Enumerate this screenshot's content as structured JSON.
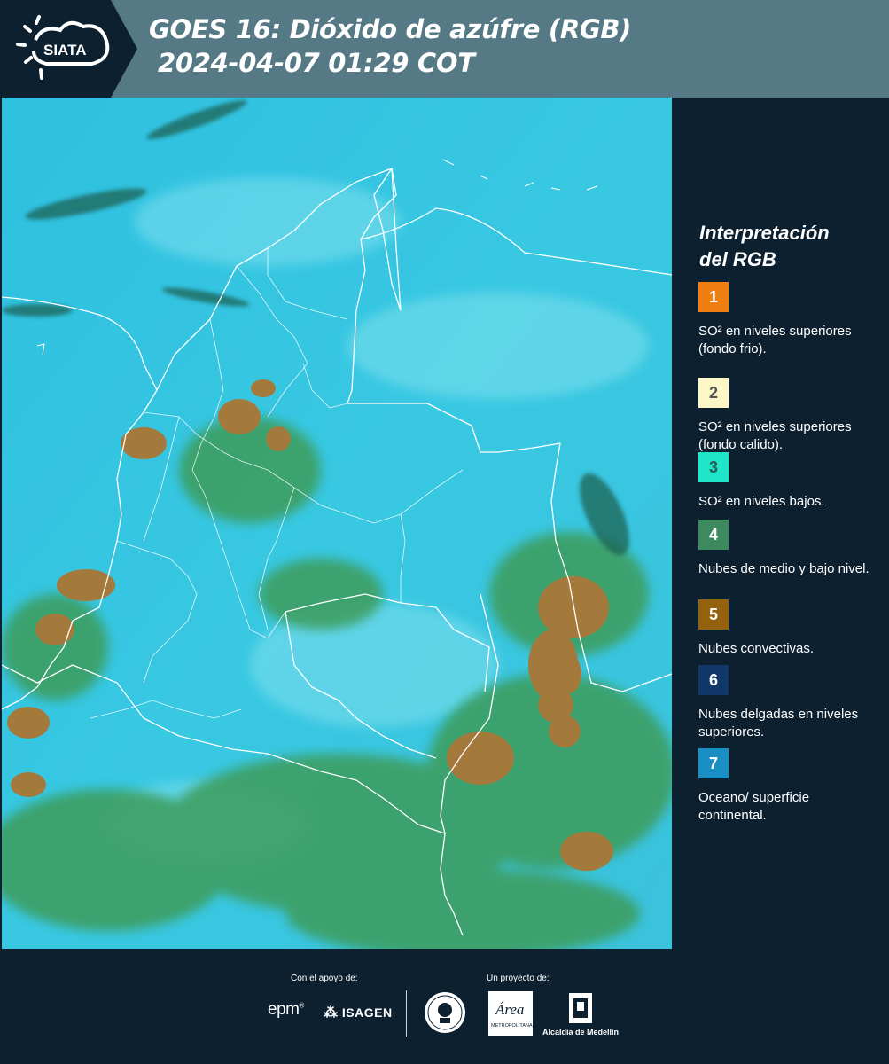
{
  "header": {
    "logo_text": "SIATA",
    "title_line1": "GOES 16: Dióxido de azúfre (RGB)",
    "title_line2": "2024-04-07 01:29 COT"
  },
  "legend": {
    "title_line1": "Interpretación",
    "title_line2": "del RGB",
    "items": [
      {
        "number": "1",
        "color": "#f07f12",
        "text_color": "#ffffff",
        "text": "SO² en niveles superiores (fondo frio)."
      },
      {
        "number": "2",
        "color": "#fdf6c6",
        "text_color": "#555555",
        "text": "SO² en niveles superiores (fondo calido)."
      },
      {
        "number": "3",
        "color": "#1fe6c8",
        "text_color": "#2a5a55",
        "text": "SO² en niveles bajos."
      },
      {
        "number": "4",
        "color": "#3d8a5e",
        "text_color": "#ffffff",
        "text": "Nubes de medio y bajo nivel."
      },
      {
        "number": "5",
        "color": "#94620f",
        "text_color": "#ffffff",
        "text": "Nubes convectivas."
      },
      {
        "number": "6",
        "color": "#12386a",
        "text_color": "#ffffff",
        "text": "Nubes delgadas en niveles superiores."
      },
      {
        "number": "7",
        "color": "#1a8fc4",
        "text_color": "#ffffff",
        "text": "Oceano/ superficie continental."
      }
    ]
  },
  "map": {
    "background_color": "#33c5df",
    "land_cloud_color": "#3f9a5a",
    "convective_color": "#a07a3a",
    "border_color": "#ffffff"
  },
  "footer": {
    "support_label": "Con el apoyo de:",
    "project_label": "Un proyecto de:",
    "sponsor_epm": "epm",
    "sponsor_isagen": "ISAGEN",
    "area_label": "METROPOLITANA",
    "alcaldia_label": "Alcaldía de Medellín"
  }
}
